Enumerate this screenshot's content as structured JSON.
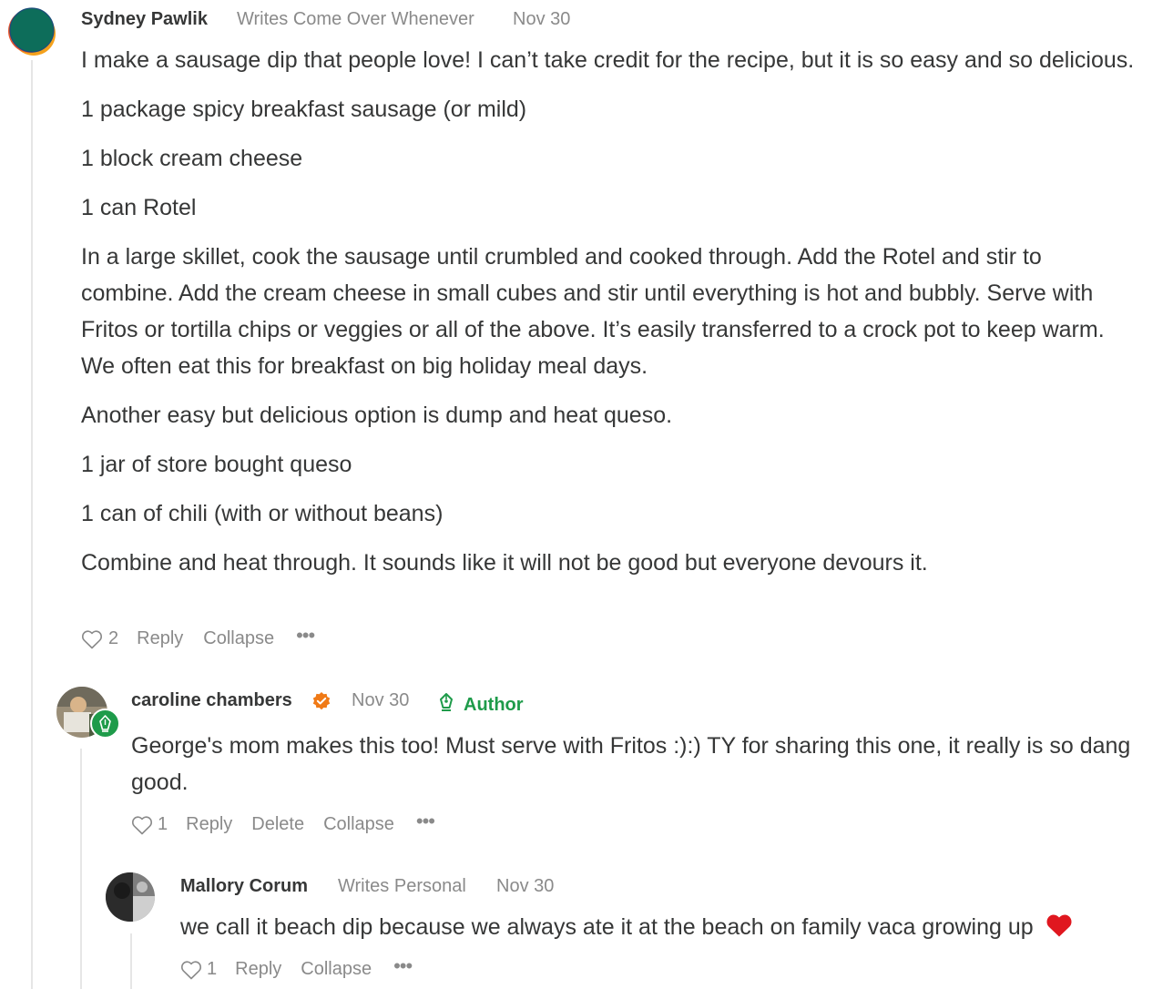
{
  "comments": [
    {
      "author": "Sydney Pawlik",
      "publication": "Writes Come Over Whenever",
      "date": "Nov 30",
      "paragraphs": [
        "I make a sausage dip that people love! I can’t take credit for the recipe, but it is so easy and so delicious.",
        "1 package spicy breakfast sausage (or mild)",
        "1 block cream cheese",
        "1 can Rotel",
        "In a large skillet, cook the sausage until crumbled and cooked through. Add the Rotel and stir to combine. Add the cream cheese in small cubes and stir until everything is hot and bubbly. Serve with Fritos or tortilla chips or veggies or all of the above. It’s easily transferred to a crock pot to keep warm. We often eat this for breakfast on big holiday meal days.",
        "Another easy but delicious option is dump and heat queso.",
        "1 jar of store bought queso",
        "1 can of chili (with or without beans)",
        "Combine and heat through. It sounds like it will not be good but everyone devours it."
      ],
      "likes": "2",
      "actions": {
        "reply": "Reply",
        "collapse": "Collapse",
        "more": "•••"
      }
    },
    {
      "author": "caroline chambers",
      "date": "Nov 30",
      "badge": "Author",
      "paragraphs": [
        "George's mom makes this too! Must serve with Fritos :):) TY for sharing this one, it really is so dang good."
      ],
      "likes": "1",
      "actions": {
        "reply": "Reply",
        "delete": "Delete",
        "collapse": "Collapse",
        "more": "•••"
      }
    },
    {
      "author": "Mallory Corum",
      "publication": "Writes Personal",
      "date": "Nov 30",
      "text": "we call it beach dip because we always ate it at the beach on family vaca growing up",
      "emoji": "❤️",
      "likes": "1",
      "actions": {
        "reply": "Reply",
        "collapse": "Collapse",
        "more": "•••"
      }
    }
  ],
  "colors": {
    "text": "#363737",
    "meta": "#8a8a8a",
    "author_green": "#1e9b4a",
    "verified_orange": "#f07a16"
  }
}
